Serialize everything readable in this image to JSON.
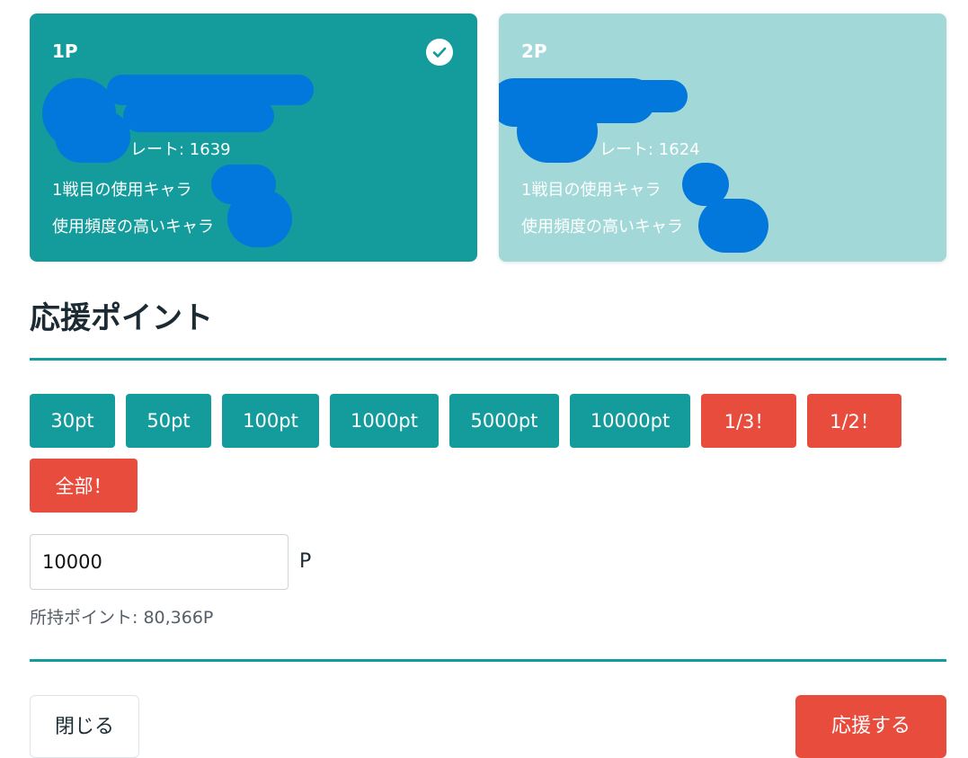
{
  "player1": {
    "label": "1P",
    "rate": "レート: 1639",
    "char_first": "1戦目の使用キャラ",
    "char_frequent": "使用頻度の高いキャラ"
  },
  "player2": {
    "label": "2P",
    "rate": "レート: 1624",
    "char_first": "1戦目の使用キャラ",
    "char_frequent": "使用頻度の高いキャラ"
  },
  "section_title": "応援ポイント",
  "amount_buttons": [
    "30pt",
    "50pt",
    "100pt",
    "1000pt",
    "5000pt",
    "10000pt"
  ],
  "ratio_buttons": [
    "1/3！",
    "1/2！",
    "全部！"
  ],
  "amount": {
    "value": "10000",
    "unit": "P"
  },
  "owned_points": "所持ポイント: 80,366P",
  "footer": {
    "close_label": "閉じる",
    "support_label": "応援する"
  },
  "colors": {
    "teal": "#149b9b",
    "teal_light": "#a2d8d8",
    "red": "#e84c3d",
    "redaction": "#0277dc"
  },
  "icons": {
    "selected": "check-circle-icon"
  }
}
